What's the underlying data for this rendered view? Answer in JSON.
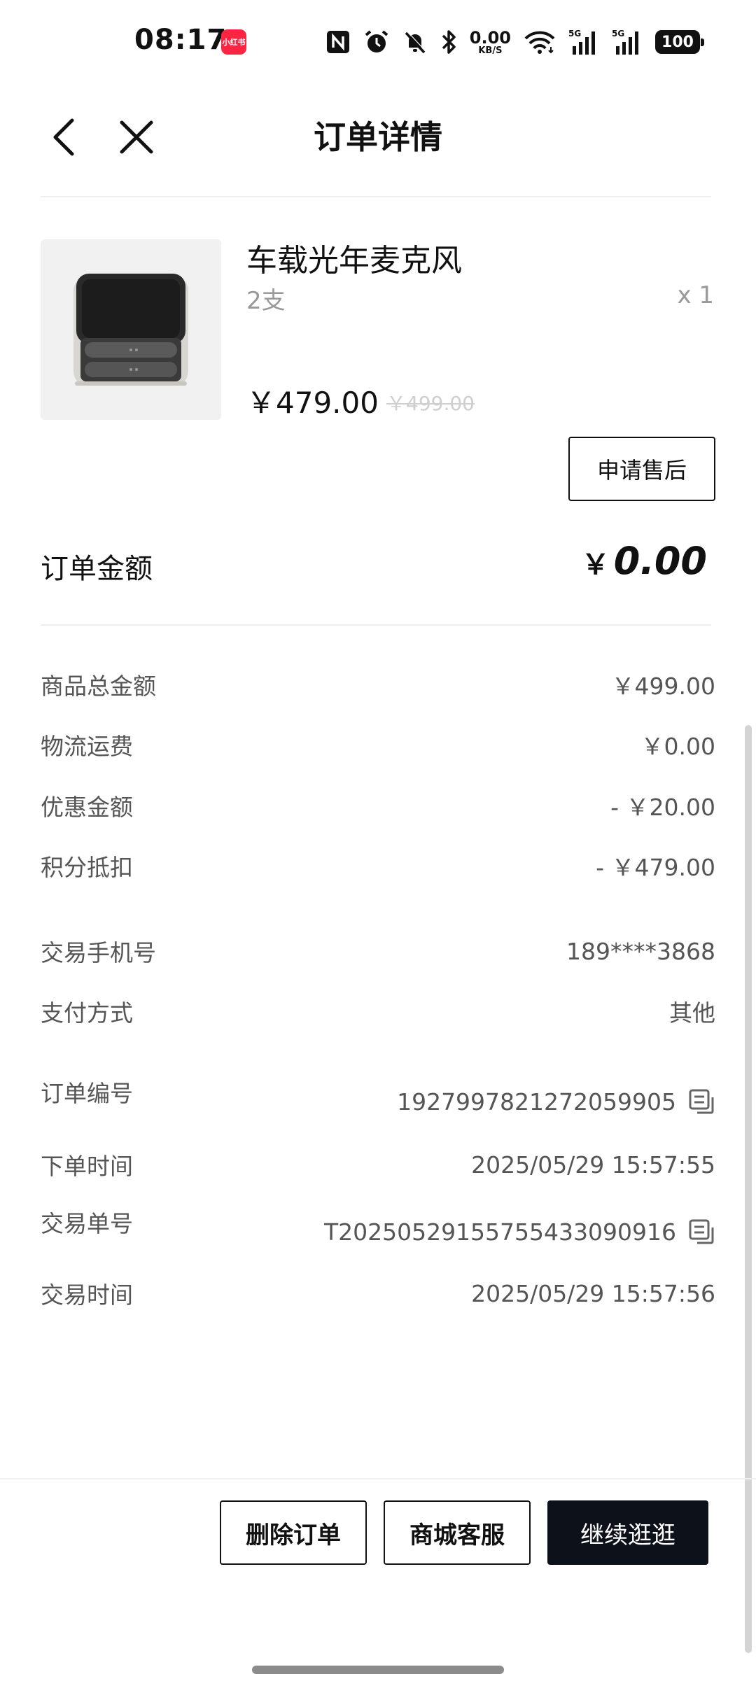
{
  "status_bar": {
    "time": "08:17",
    "app_badge": "小红书",
    "net_speed_value": "0.00",
    "net_speed_unit": "KB/S",
    "signal1_label": "5G",
    "signal2_label": "5G",
    "battery": "100",
    "icons": [
      "nfc-icon",
      "alarm-icon",
      "mute-icon",
      "bluetooth-icon",
      "wifi-icon",
      "signal-icon",
      "signal-icon",
      "battery-icon"
    ]
  },
  "header": {
    "title": "订单详情",
    "back_icon": "chevron-left-icon",
    "close_icon": "close-icon"
  },
  "product": {
    "name": "车载光年麦克风",
    "spec": "2支",
    "quantity": "x 1",
    "price": "￥479.00",
    "original_price": "￥499.00",
    "after_sale_label": "申请售后"
  },
  "order_amount": {
    "label": "订单金额",
    "currency": "￥",
    "value": "0.00"
  },
  "breakdown": [
    {
      "label": "商品总金额",
      "value": "￥499.00"
    },
    {
      "label": "物流运费",
      "value": "￥0.00"
    },
    {
      "label": "优惠金额",
      "value": "- ￥20.00"
    },
    {
      "label": "积分抵扣",
      "value": "- ￥479.00"
    }
  ],
  "contact": [
    {
      "label": "交易手机号",
      "value": "189****3868"
    },
    {
      "label": "支付方式",
      "value": "其他"
    }
  ],
  "order_info": [
    {
      "label": "订单编号",
      "value": "1927997821272059905",
      "copyable": true
    },
    {
      "label": "下单时间",
      "value": "2025/05/29 15:57:55",
      "copyable": false
    },
    {
      "label": "交易单号",
      "value": "T2025052915575543309​0916",
      "copyable": true
    },
    {
      "label": "交易时间",
      "value": "2025/05/29 15:57:56",
      "copyable": false
    }
  ],
  "footer": {
    "delete_label": "删除订单",
    "service_label": "商城客服",
    "continue_label": "继续逛逛"
  },
  "colors": {
    "primary_dark": "#0d111a",
    "text_secondary": "#555555",
    "text_muted": "#999999",
    "badge_red": "#ff2442"
  }
}
